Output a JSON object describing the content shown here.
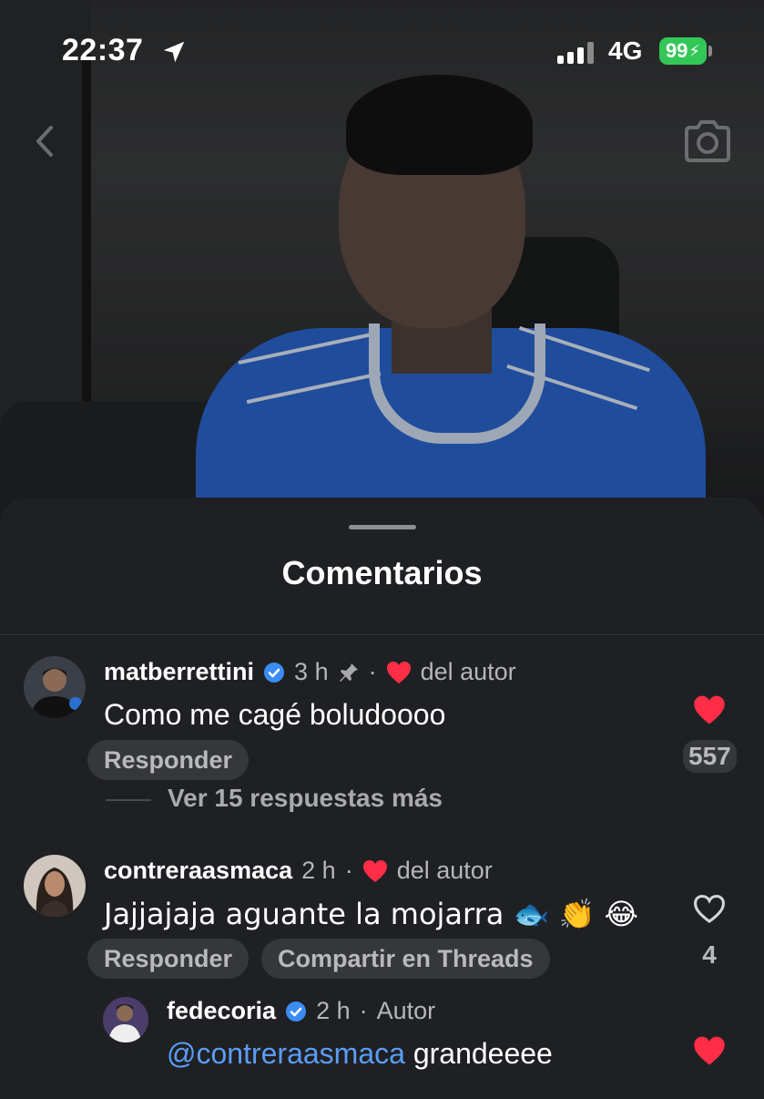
{
  "status_bar": {
    "time": "22:37",
    "network": "4G",
    "battery": "99",
    "colors": {
      "battery": "#33c758"
    },
    "icons": [
      "location-arrow-icon",
      "signal-icon",
      "battery-icon"
    ]
  },
  "nav": {
    "back_icon": "chevron-left-icon",
    "camera_icon": "camera-icon"
  },
  "sheet": {
    "title": "Comentarios"
  },
  "comments": [
    {
      "username": "matberrettini",
      "verified": true,
      "time": "3 h",
      "pinned": true,
      "author_like": "del autor",
      "text": "Como me cagé boludoooo",
      "reply_label": "Responder",
      "likes": "557",
      "liked": true,
      "view_replies": "Ver 15 respuestas más"
    },
    {
      "username": "contreraasmaca",
      "verified": false,
      "time": "2 h",
      "author_like": "del autor",
      "text": "Jajjajaja aguante la mojarra 🐟 👏 😂",
      "reply_label": "Responder",
      "share_label": "Compartir en Threads",
      "likes": "4",
      "liked": false,
      "replies": [
        {
          "username": "fedecoria",
          "verified": true,
          "time": "2 h",
          "badge": "Autor",
          "mention": "@contreraasmaca",
          "text": "grandeeee",
          "liked": true
        }
      ]
    }
  ],
  "colors": {
    "like": "#ff2d45",
    "mention": "#5b9df5",
    "verified": "#3b8df5",
    "sheet_bg": "#1f2024"
  }
}
